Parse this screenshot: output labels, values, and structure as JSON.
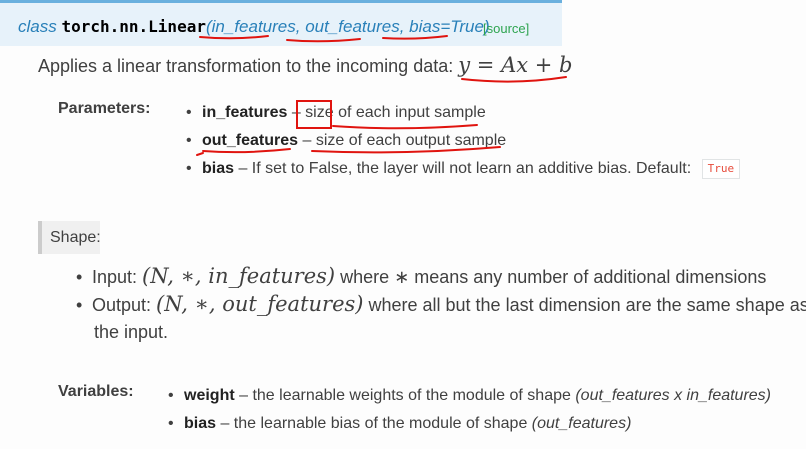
{
  "signature": {
    "keyword": "class",
    "name": "torch.nn.Linear",
    "open_paren": "(",
    "params": "in_features, out_features, bias=True",
    "close_paren": ")",
    "source_link": "[source]"
  },
  "description": {
    "text": "Applies a linear transformation to the incoming data: ",
    "formula_y": "y",
    "formula_eq": " = ",
    "formula_rhs": "Ax",
    "formula_plus": " + ",
    "formula_b": "b"
  },
  "parameters": {
    "label": "Parameters:",
    "items": [
      {
        "name": "in_features",
        "desc": " – size of each input sample"
      },
      {
        "name": "out_features",
        "desc": " – size of each output sample"
      },
      {
        "name": "bias",
        "desc": " – If set to False, the layer will not learn an additive bias. Default: ",
        "default": "True"
      }
    ]
  },
  "shape": {
    "label": "Shape:",
    "input_label": "Input: ",
    "input_math": "(N, ∗, in_features)",
    "input_desc": " where ∗ means any number of additional dimensions",
    "output_label": "Output: ",
    "output_math": "(N, ∗, out_features)",
    "output_desc": " where all but the last dimension are the same shape as",
    "output_desc_cont": "the input."
  },
  "variables": {
    "label": "Variables:",
    "items": [
      {
        "name": "weight",
        "desc": " – the learnable weights of the module of shape ",
        "shape": "(out_features x in_features)"
      },
      {
        "name": "bias",
        "desc": " – the learnable bias of the module of shape ",
        "shape": "(out_features)"
      }
    ]
  },
  "annotation_color": "#e0140f"
}
